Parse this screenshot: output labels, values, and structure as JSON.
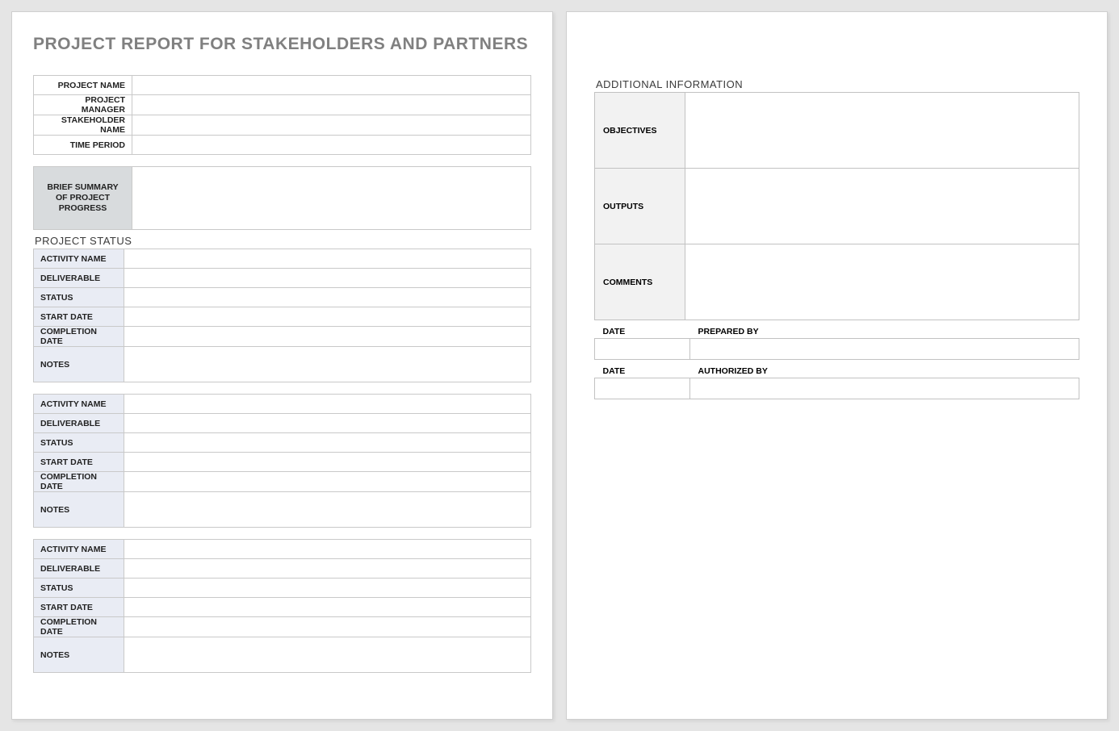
{
  "title": "PROJECT REPORT FOR STAKEHOLDERS AND PARTNERS",
  "header_fields": {
    "project_name_label": "PROJECT NAME",
    "project_manager_label": "PROJECT MANAGER",
    "stakeholder_name_label": "STAKEHOLDER NAME",
    "time_period_label": "TIME PERIOD",
    "project_name_value": "",
    "project_manager_value": "",
    "stakeholder_name_value": "",
    "time_period_value": ""
  },
  "summary": {
    "label": "BRIEF SUMMARY OF PROJECT PROGRESS",
    "value": ""
  },
  "project_status_label": "PROJECT STATUS",
  "activity_labels": {
    "activity_name": "ACTIVITY NAME",
    "deliverable": "DELIVERABLE",
    "status": "STATUS",
    "start_date": "START DATE",
    "completion_date": "COMPLETION DATE",
    "notes": "NOTES"
  },
  "activities": [
    {
      "activity_name": "",
      "deliverable": "",
      "status": "",
      "start_date": "",
      "completion_date": "",
      "notes": ""
    },
    {
      "activity_name": "",
      "deliverable": "",
      "status": "",
      "start_date": "",
      "completion_date": "",
      "notes": ""
    },
    {
      "activity_name": "",
      "deliverable": "",
      "status": "",
      "start_date": "",
      "completion_date": "",
      "notes": ""
    }
  ],
  "additional_info_label": "ADDITIONAL INFORMATION",
  "additional_info": {
    "objectives_label": "OBJECTIVES",
    "outputs_label": "OUTPUTS",
    "comments_label": "COMMENTS",
    "objectives_value": "",
    "outputs_value": "",
    "comments_value": ""
  },
  "signoff": {
    "date_label": "DATE",
    "prepared_by_label": "PREPARED BY",
    "authorized_by_label": "AUTHORIZED BY",
    "prepared_date": "",
    "prepared_by": "",
    "authorized_date": "",
    "authorized_by": ""
  }
}
